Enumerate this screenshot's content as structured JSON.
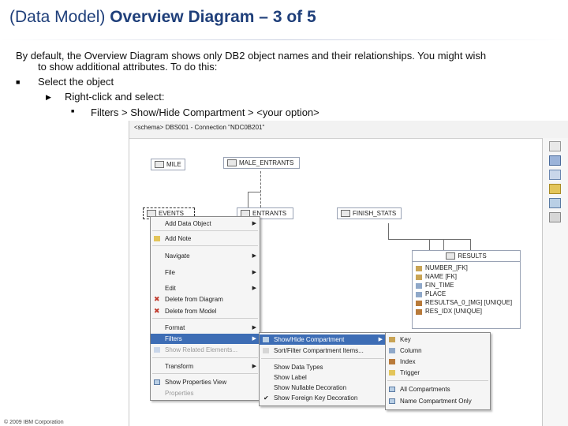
{
  "slide": {
    "title_prefix": "(Data Model) ",
    "title_bold": "Overview Diagram – 3 of 5",
    "intro_line1": "By default, the Overview Diagram shows only DB2 object names and their relationships.  You might wish",
    "intro_line2": "to show additional attributes.  To do this:",
    "bullet1": "Select the object",
    "bullet2": "Right-click and select:",
    "bullet3": "Filters  >  Show/Hide Compartment  >     <your option>",
    "footer": "© 2009 IBM Corporation"
  },
  "editor": {
    "tab_label": "<schema> DBS001 - Connection \"NDC0B201\""
  },
  "entities": {
    "mile": "MILE",
    "male_entrants": "MALE_ENTRANTS",
    "events": "EVENTS",
    "entrants": "ENTRANTS",
    "finish_stats": "FINISH_STATS",
    "results": "RESULTS",
    "results_columns": [
      "NUMBER_[FK]",
      "NAME [FK]",
      "FIN_TIME",
      "PLACE",
      "RESULTSA_0_[MG] [UNIQUE]",
      "RES_IDX [UNIQUE]"
    ]
  },
  "context_menu": {
    "items": [
      "Add Data Object",
      "Add Note",
      "Navigate",
      "File",
      "Edit",
      "Delete from Diagram",
      "Delete from Model",
      "Format",
      "Filters",
      "Show Related Elements...",
      "Transform",
      "Show Properties View",
      "Properties"
    ]
  },
  "filters_menu": {
    "items": [
      "Show/Hide Compartment",
      "Sort/Filter Compartment Items...",
      "Show Data Types",
      "Show Label",
      "Show Nullable Decoration",
      "Show Foreign Key Decoration"
    ]
  },
  "compartment_menu": {
    "items": [
      "Key",
      "Column",
      "Index",
      "Trigger",
      "All Compartments",
      "Name Compartment Only"
    ]
  }
}
